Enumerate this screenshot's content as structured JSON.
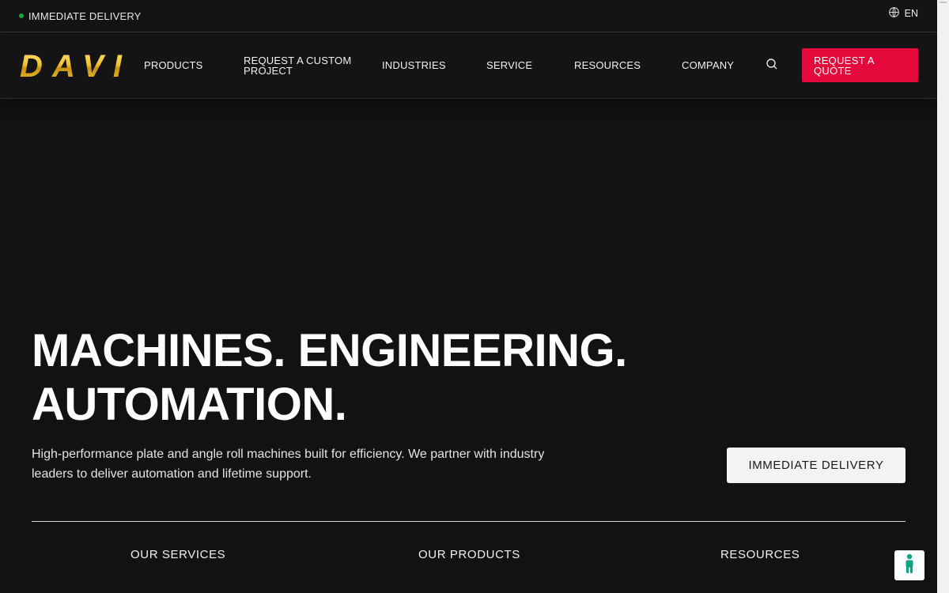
{
  "topbar": {
    "status_link": "IMMEDIATE DELIVERY",
    "language": "EN",
    "colors": {
      "status_dot": "#1fa24a"
    }
  },
  "header": {
    "logo_text": "DAVI",
    "nav": {
      "products": "PRODUCTS",
      "custom_project": "REQUEST A CUSTOM PROJECT",
      "industries": "INDUSTRIES",
      "service": "SERVICE",
      "resources": "RESOURCES",
      "company": "COMPANY"
    },
    "search_icon": "search-icon",
    "quote_button": "REQUEST A QUOTE",
    "colors": {
      "quote_button": "#e5093b",
      "logo_gold": "#f2c230"
    }
  },
  "hero": {
    "title_line1": "MACHINES. ENGINEERING.",
    "title_line2": "AUTOMATION.",
    "description": "High-performance plate and angle roll machines built for efficiency. We partner with industry leaders to deliver automation and lifetime support.",
    "cta": "IMMEDIATE DELIVERY"
  },
  "bottom_nav": {
    "services": "OUR SERVICES",
    "products": "OUR PRODUCTS",
    "resources": "RESOURCES"
  },
  "accessibility": {
    "icon": "accessibility-icon",
    "color": "#10a37f"
  }
}
